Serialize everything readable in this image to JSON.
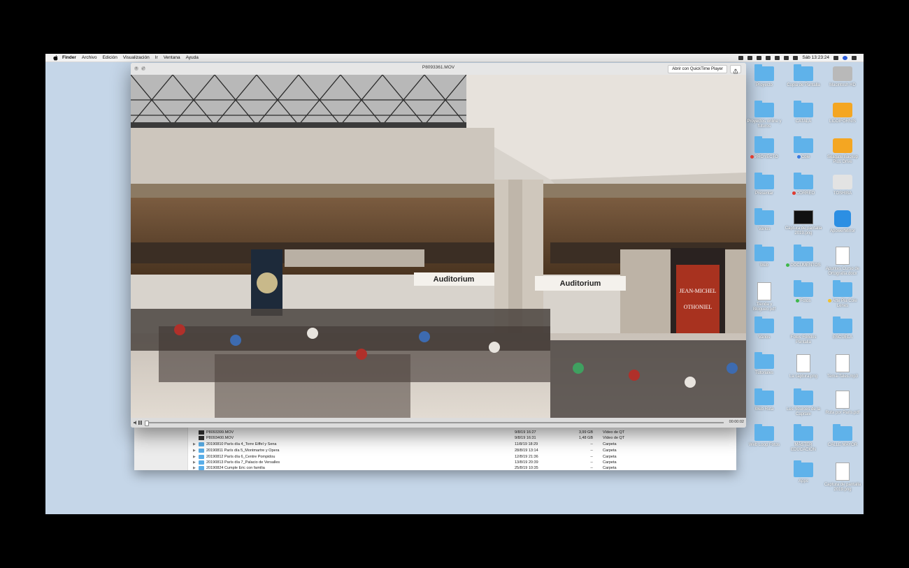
{
  "menubar": {
    "apple": "apple-icon",
    "items": [
      "Finder",
      "Archivo",
      "Edición",
      "Visualización",
      "Ir",
      "Ventana",
      "Ayuda"
    ],
    "clock": "Sáb 13:23:24"
  },
  "quicklook": {
    "title": "P8093361.MOV",
    "open_button": "Abrir con QuickTime Player",
    "time": "00:00:02",
    "video_signs": [
      "Auditorium",
      "Auditorium"
    ],
    "poster_lines": [
      "JEAN-MICHEL",
      "OTHONIEL"
    ]
  },
  "finder": {
    "rows": [
      {
        "name": "P8093399.MOV",
        "date": "9/8/19 16:27",
        "size": "3,99 GB",
        "kind": "Vídeo de QT",
        "folder": false
      },
      {
        "name": "P8093400.MOV",
        "date": "9/8/19 16:31",
        "size": "1,48 GB",
        "kind": "Vídeo de QT",
        "folder": false
      },
      {
        "name": "20190810 París día 4_Torre Eiffel y Sena",
        "date": "11/8/19 18:29",
        "size": "--",
        "kind": "Carpeta",
        "folder": true
      },
      {
        "name": "20190811 París día 5_Montmartre y Ópera",
        "date": "28/8/19 13:14",
        "size": "--",
        "kind": "Carpeta",
        "folder": true
      },
      {
        "name": "20190812 París día 6_Centre Pompidou",
        "date": "12/8/19 21:36",
        "size": "--",
        "kind": "Carpeta",
        "folder": true
      },
      {
        "name": "20190813 París día 7_Palacio de Versalles",
        "date": "13/8/19 20:39",
        "size": "--",
        "kind": "Carpeta",
        "folder": true
      },
      {
        "name": "20190824 Cumple Eric con familia",
        "date": "25/8/19 10:35",
        "size": "--",
        "kind": "Carpeta",
        "folder": true
      }
    ]
  },
  "desktop": {
    "columns": [
      [
        {
          "label": "Proyecto",
          "type": "folder"
        },
        {
          "label": "Proyectos online y futuros",
          "type": "folder"
        },
        {
          "label": "PROYECTO",
          "type": "folder",
          "tag": "#e03b30"
        },
        {
          "label": "Presentar",
          "type": "folder"
        },
        {
          "label": "Varios",
          "type": "folder"
        },
        {
          "label": "Web",
          "type": "folder"
        },
        {
          "label": "Tienda y Blogueo.pdf",
          "type": "doc"
        },
        {
          "label": "Varios",
          "type": "folder"
        },
        {
          "label": "Tutoriales",
          "type": "folder"
        },
        {
          "label": "Web Ruta",
          "type": "folder"
        },
        {
          "label": "Web Loop Fotos",
          "type": "folder"
        }
      ],
      [
        {
          "label": "Copia de Pantalla",
          "type": "folder"
        },
        {
          "label": "CATALÀ",
          "type": "folder"
        },
        {
          "label": "Cole",
          "type": "folder",
          "tag": "#3a7be0"
        },
        {
          "label": "CORREO",
          "type": "folder",
          "tag": "#e03b30"
        },
        {
          "label": "Captura de pantalla 2019.png",
          "type": "screen"
        },
        {
          "label": "DOCUMENTOS",
          "type": "folder",
          "tag": "#3fb84a"
        },
        {
          "label": "Fotos",
          "type": "folder",
          "tag": "#3fb84a"
        },
        {
          "label": "Fotos Fondos Pantalla",
          "type": "folder"
        },
        {
          "label": "La captura.png",
          "type": "doc"
        },
        {
          "label": "Les Sources de la Capitale",
          "type": "folder"
        },
        {
          "label": "MÁSTER EDUCACIÓN",
          "type": "folder"
        },
        {
          "label": "Apps",
          "type": "folder"
        }
      ],
      [
        {
          "label": "Macintosh HD",
          "type": "drive"
        },
        {
          "label": "LIDDIFORNIS",
          "type": "drive-orange"
        },
        {
          "label": "Seagate Backup Plus Drive",
          "type": "drive-orange"
        },
        {
          "label": "TOSHIBA",
          "type": "drive-silver"
        },
        {
          "label": "ApowerMirror",
          "type": "app"
        },
        {
          "label": "Apuntes Curso de Ortografía.docx",
          "type": "doc"
        },
        {
          "label": "Arte Pia Cole Lenes",
          "type": "folder",
          "tag": "#f2c12e"
        },
        {
          "label": "ESCUELA",
          "type": "folder"
        },
        {
          "label": "Tema-Tales.mp3",
          "type": "doc"
        },
        {
          "label": "Ruta por París.pdf",
          "type": "doc"
        },
        {
          "label": "CALLE MAYOR",
          "type": "folder"
        },
        {
          "label": "Captura de pantalla 2019.png",
          "type": "doc"
        }
      ]
    ]
  }
}
